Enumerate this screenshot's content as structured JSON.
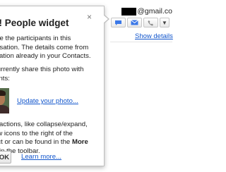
{
  "contact": {
    "email_domain": "@gmail.co",
    "show_details": "Show details"
  },
  "popup": {
    "title": "v! People widget",
    "close": "×",
    "intro_lines": [
      "are the participants in this",
      "ersation. The details come from",
      "mation already in your Contacts."
    ],
    "share_lines": [
      "currently share this photo with",
      "ients:"
    ],
    "update_photo": "Update your photo...",
    "tips_lines": [
      "e actions, like collapse/expand,",
      "ow icons to the right of the",
      "ect or can be found in the",
      "u in the toolbar."
    ],
    "tips_more": "More",
    "ok": "OK",
    "learn_more": "Learn more..."
  },
  "colors": {
    "link": "#1155cc",
    "border": "#bfbfbf"
  },
  "icons": [
    "chat-icon",
    "mail-icon",
    "phone-icon",
    "dropdown-arrow-icon",
    "close-icon"
  ]
}
